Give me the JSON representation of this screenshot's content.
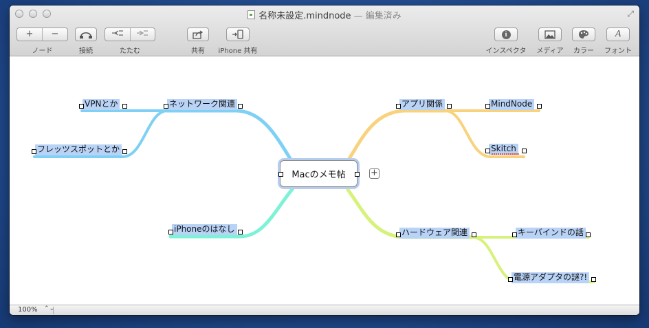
{
  "window": {
    "title": "名称未設定.mindnode",
    "status": " — 編集済み"
  },
  "toolbar": {
    "node_label": "ノード",
    "node_add": "+",
    "node_remove": "−",
    "connect_label": "接続",
    "fold_label": "たたむ",
    "share_label": "共有",
    "iphone_share_label": "iPhone 共有",
    "inspector_label": "インスペクタ",
    "media_label": "メディア",
    "color_label": "カラー",
    "font_label": "フォント",
    "font_glyph": "A",
    "inspector_glyph": "i"
  },
  "mindmap": {
    "root": "Macのメモ帖",
    "add_button": "+",
    "nodes": {
      "network": "ネットワーク関連",
      "vpn": "VPNとか",
      "flets": "フレッツスポットとか",
      "iphone": "iPhoneのはなし",
      "apps": "アプリ関係",
      "mindnode": "MindNode",
      "skitch": "Skitch",
      "hardware": "ハードウェア関連",
      "keybind": "キーバインドの話",
      "adapter": "電源アダプタの謎?!"
    },
    "colors": {
      "blue": "#7fd0f5",
      "cyan": "#7ef2d6",
      "orange": "#f9d27d",
      "lime": "#d6f27a",
      "node_bg": "#b9d3f7"
    }
  },
  "statusbar": {
    "zoom": "100%",
    "zoom_arrow": "⌃⌄"
  }
}
